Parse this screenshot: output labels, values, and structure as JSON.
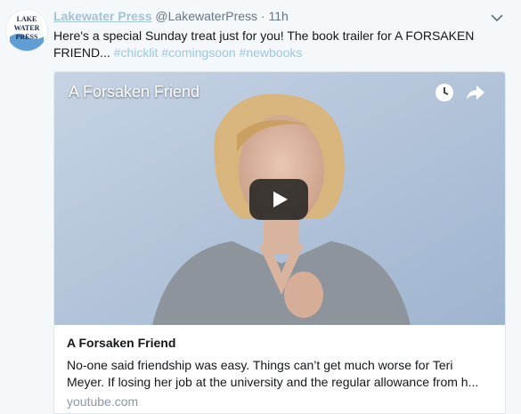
{
  "tweet": {
    "author_name": "Lakewater Press",
    "author_handle": "@LakewaterPress",
    "separator": "·",
    "time": "11h",
    "text": "Here's a special Sunday treat just for you! The book trailer for A FORSAKEN FRIEND...",
    "hashtags": [
      "#chicklit",
      "#comingsoon",
      "#newbooks"
    ],
    "avatar_text": [
      "LAKE",
      "WATER",
      "PRESS"
    ]
  },
  "card": {
    "video_title": "A Forsaken Friend",
    "title": "A Forsaken Friend",
    "description": "No-one said friendship was easy. Things can’t get much worse for Teri Meyer. If losing her job at the university and the regular allowance from h...",
    "domain": "youtube.com"
  },
  "icons": {
    "menu": "chevron-down-icon",
    "watch_later": "clock-icon",
    "share": "share-icon",
    "play": "play-icon"
  },
  "colors": {
    "author_name": "#a3c3d6",
    "hashtag": "#98c9e5",
    "muted": "#657786",
    "background": "#f5f8fa"
  }
}
